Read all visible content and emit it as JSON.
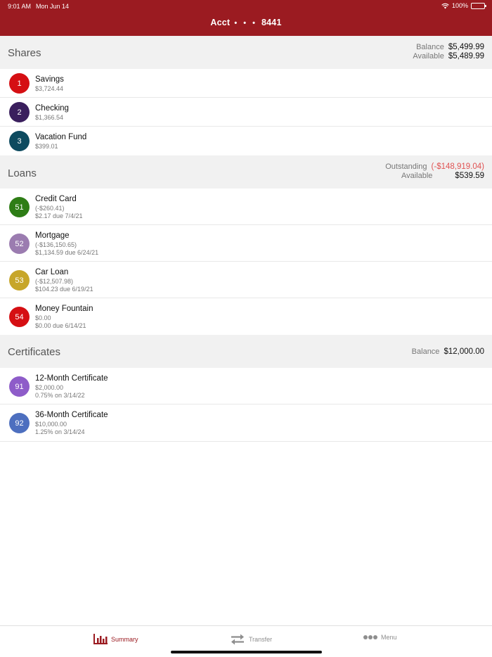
{
  "status": {
    "time": "9:01 AM",
    "date": "Mon Jun 14",
    "battery": "100%"
  },
  "header": {
    "title_prefix": "Acct",
    "title_dots": "• • •",
    "title_suffix": "8441"
  },
  "shares": {
    "title": "Shares",
    "balance_label": "Balance",
    "balance": "$5,499.99",
    "available_label": "Available",
    "available": "$5,489.99",
    "items": [
      {
        "num": "1",
        "name": "Savings",
        "amount": "$3,724.44",
        "color": "#d50f13"
      },
      {
        "num": "2",
        "name": "Checking",
        "amount": "$1,366.54",
        "color": "#3a1f5d"
      },
      {
        "num": "3",
        "name": "Vacation Fund",
        "amount": "$399.01",
        "color": "#0d4a5f"
      }
    ]
  },
  "loans": {
    "title": "Loans",
    "outstanding_label": "Outstanding",
    "outstanding": "(-$148,919.04)",
    "available_label": "Available",
    "available": "$539.59",
    "items": [
      {
        "num": "51",
        "name": "Credit Card",
        "amount": "(-$260.41)",
        "due": "$2.17 due 7/4/21",
        "color": "#2e7d16"
      },
      {
        "num": "52",
        "name": "Mortgage",
        "amount": "(-$136,150.65)",
        "due": "$1,134.59 due 6/24/21",
        "color": "#9b7cb0"
      },
      {
        "num": "53",
        "name": "Car Loan",
        "amount": "(-$12,507.98)",
        "due": "$104.23 due 6/19/21",
        "color": "#c7a62a"
      },
      {
        "num": "54",
        "name": "Money Fountain",
        "amount": "$0.00",
        "due": "$0.00 due 6/14/21",
        "color": "#d50f13"
      }
    ]
  },
  "certificates": {
    "title": "Certificates",
    "balance_label": "Balance",
    "balance": "$12,000.00",
    "items": [
      {
        "num": "91",
        "name": "12-Month Certificate",
        "amount": "$2,000.00",
        "rate": "0.75% on 3/14/22",
        "color": "#8e5cc9"
      },
      {
        "num": "92",
        "name": "36-Month Certificate",
        "amount": "$10,000.00",
        "rate": "1.25% on 3/14/24",
        "color": "#4d6fbf"
      }
    ]
  },
  "tabs": {
    "summary": "Summary",
    "transfer": "Transfer",
    "menu": "Menu",
    "active_color": "#9b1b21",
    "icons": {
      "summary": "bar-chart-icon",
      "transfer": "transfer-arrows-icon",
      "menu": "more-dots-icon"
    }
  }
}
